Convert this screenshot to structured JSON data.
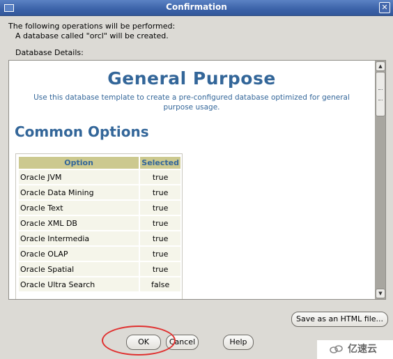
{
  "window": {
    "title": "Confirmation",
    "close_glyph": "✕"
  },
  "intro": {
    "line1": "The following operations will be performed:",
    "line2": "A database called \"orcl\" will be created."
  },
  "details_label": "Database Details:",
  "details": {
    "heading": "General Purpose",
    "description": "Use this database template to create a pre-configured database optimized for general purpose usage.",
    "section_title": "Common Options",
    "table": {
      "columns": [
        "Option",
        "Selected"
      ],
      "rows": [
        {
          "option": "Oracle JVM",
          "selected": "true"
        },
        {
          "option": "Oracle Data Mining",
          "selected": "true"
        },
        {
          "option": "Oracle Text",
          "selected": "true"
        },
        {
          "option": "Oracle XML DB",
          "selected": "true"
        },
        {
          "option": "Oracle Intermedia",
          "selected": "true"
        },
        {
          "option": "Oracle OLAP",
          "selected": "true"
        },
        {
          "option": "Oracle Spatial",
          "selected": "true"
        },
        {
          "option": "Oracle Ultra Search",
          "selected": "false"
        }
      ]
    }
  },
  "buttons": {
    "save_html": "Save as an HTML file...",
    "ok": "OK",
    "cancel": "Cancel",
    "help": "Help"
  },
  "watermark": {
    "text": "亿速云"
  },
  "colors": {
    "title_bar": "#3b62a8",
    "heading": "#336699",
    "table_header": "#ccc98f",
    "table_cell": "#f5f5ea",
    "highlight_circle": "#e0302f"
  },
  "icons": [
    "window-menu-icon",
    "close-icon",
    "scroll-up-icon",
    "scroll-down-icon",
    "watermark-logo-icon"
  ]
}
